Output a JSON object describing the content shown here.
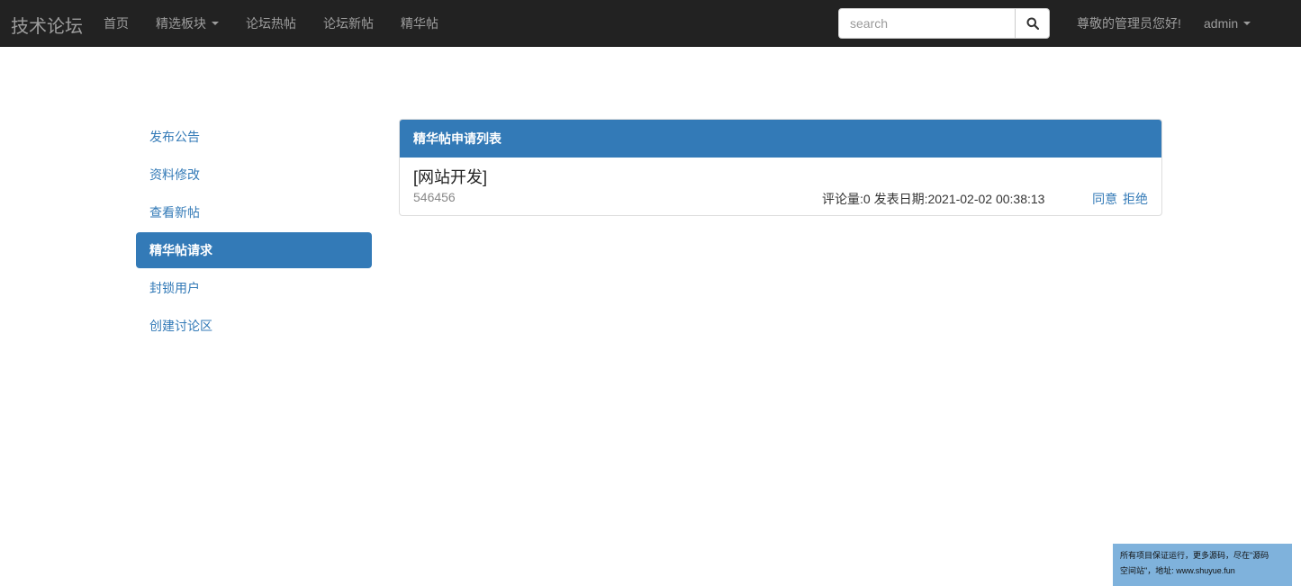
{
  "navbar": {
    "brand": "技术论坛",
    "items": [
      {
        "label": "首页"
      },
      {
        "label": "精选板块",
        "dropdown": true
      },
      {
        "label": "论坛热帖"
      },
      {
        "label": "论坛新帖"
      },
      {
        "label": "精华帖"
      }
    ],
    "search_placeholder": "search",
    "search_icon": "search-icon",
    "greeting": "尊敬的管理员您好!",
    "user": "admin"
  },
  "sidebar": {
    "items": [
      {
        "label": "发布公告"
      },
      {
        "label": "资料修改"
      },
      {
        "label": "查看新帖"
      },
      {
        "label": "精华帖请求",
        "active": true
      },
      {
        "label": "封锁用户"
      },
      {
        "label": "创建讨论区"
      }
    ]
  },
  "panel": {
    "heading": "精华帖申请列表",
    "posts": [
      {
        "title": "[网站开发]",
        "author": "546456",
        "meta": "评论量:0 发表日期:2021-02-02 00:38:13",
        "approve": "同意",
        "reject": "拒绝"
      }
    ]
  },
  "watermark": {
    "line1": "所有项目保证运行，更多源码，尽在\"源码",
    "line2": "空间站\"，地址: www.shuyue.fun"
  },
  "colors": {
    "navbar_bg": "#222222",
    "nav_text": "#9d9d9d",
    "primary": "#337ab7",
    "watermark_bg": "#7fb2dc"
  }
}
